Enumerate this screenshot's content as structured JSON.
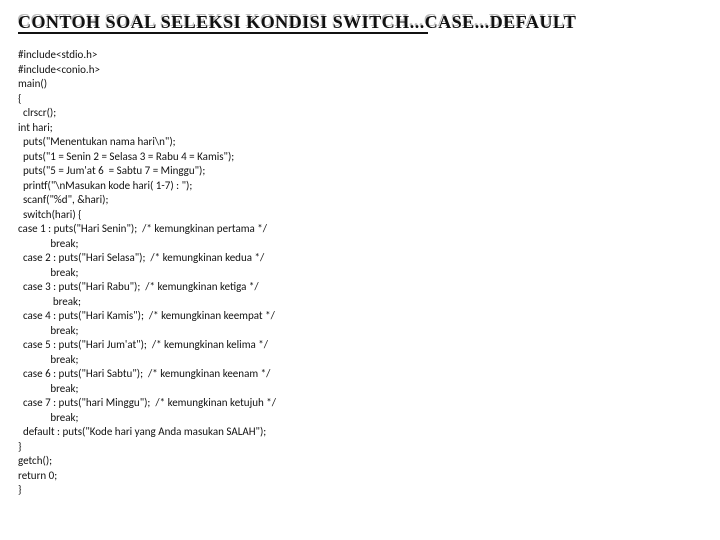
{
  "title": "CONTOH SOAL SELEKSI KONDISI SWITCH...CASE...DEFAULT",
  "code_lines": [
    "#include<stdio.h>",
    "#include<conio.h>",
    "main()",
    "{",
    "  clrscr();",
    "int hari;",
    "  puts(\"Menentukan nama hari\\n\");",
    "  puts(\"1 = Senin 2 = Selasa 3 = Rabu 4 = Kamis\");",
    "  puts(\"5 = Jum'at 6  = Sabtu 7 = Minggu\");",
    "  printf(\"\\nMasukan kode hari( 1-7) : \");",
    "  scanf(\"%d\", &hari);",
    "  switch(hari) {",
    "case 1 : puts(\"Hari Senin\");  /* kemungkinan pertama */",
    "             break;",
    "  case 2 : puts(\"Hari Selasa\");  /* kemungkinan kedua */",
    "             break;",
    "  case 3 : puts(\"Hari Rabu\");  /* kemungkinan ketiga */",
    "              break;",
    "  case 4 : puts(\"Hari Kamis\");  /* kemungkinan keempat */",
    "             break;",
    "  case 5 : puts(\"Hari Jum'at\");  /* kemungkinan kelima */",
    "             break;",
    "  case 6 : puts(\"Hari Sabtu\");  /* kemungkinan keenam */",
    "             break;",
    "  case 7 : puts(\"hari Minggu\");  /* kemungkinan ketujuh */",
    "             break;",
    "  default : puts(\"Kode hari yang Anda masukan SALAH\");",
    "}",
    "getch();",
    "return 0;",
    "}"
  ]
}
